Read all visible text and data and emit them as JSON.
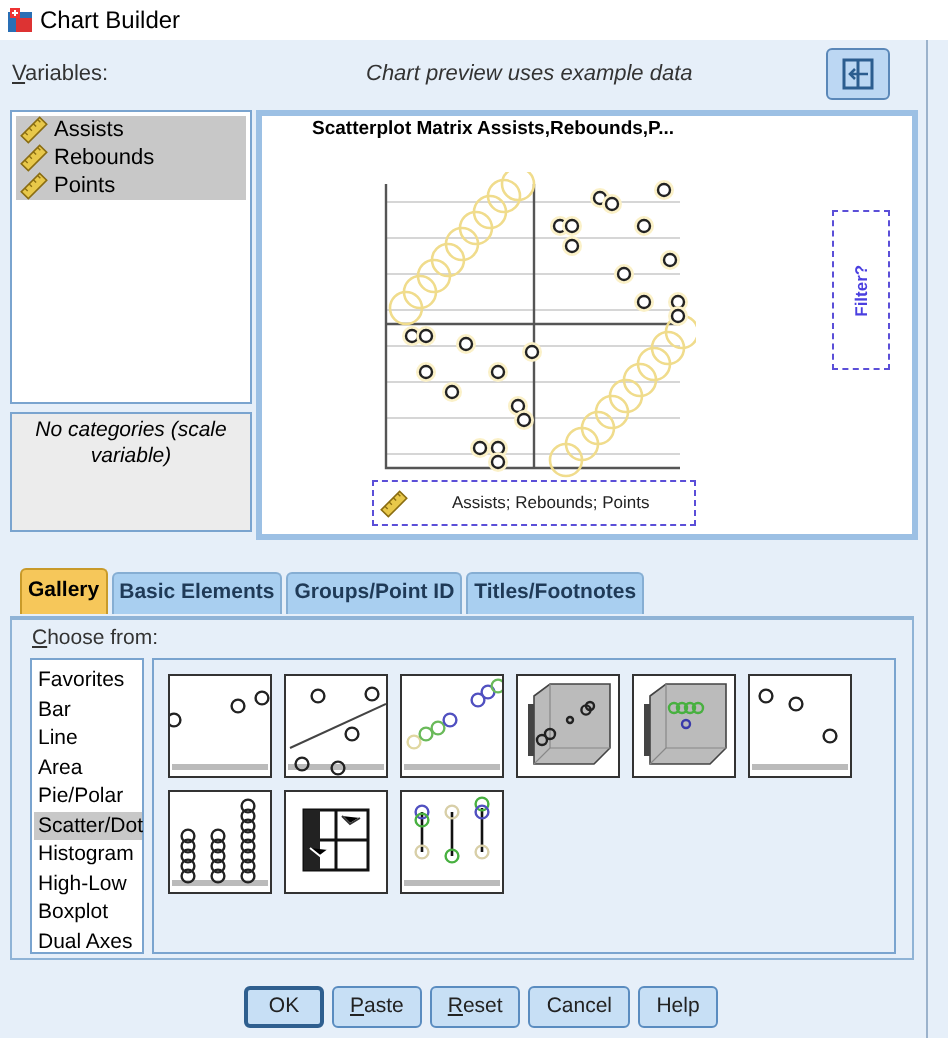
{
  "window": {
    "title": "Chart Builder"
  },
  "variables": {
    "label": "Variables:",
    "mnemonic": true,
    "items": [
      {
        "name": "Assists",
        "selected": true
      },
      {
        "name": "Rebounds",
        "selected": true
      },
      {
        "name": "Points",
        "selected": true
      }
    ]
  },
  "preview_note": "Chart preview uses example data",
  "categories_note": "No categories (scale variable)",
  "preview": {
    "title": "Scatterplot Matrix Assists,Rebounds,P...",
    "filter_label": "Filter?",
    "x_axis_label": "Assists; Rebounds; Points"
  },
  "tabs": [
    {
      "label": "Gallery",
      "selected": true
    },
    {
      "label": "Basic Elements",
      "selected": false
    },
    {
      "label": "Groups/Point ID",
      "selected": false
    },
    {
      "label": "Titles/Footnotes",
      "selected": false
    }
  ],
  "gallery": {
    "label": "Choose from:",
    "mnemonic": true,
    "types": [
      {
        "label": "Favorites",
        "selected": false
      },
      {
        "label": "Bar",
        "selected": false
      },
      {
        "label": "Line",
        "selected": false
      },
      {
        "label": "Area",
        "selected": false
      },
      {
        "label": "Pie/Polar",
        "selected": false
      },
      {
        "label": "Scatter/Dot",
        "selected": true
      },
      {
        "label": "Histogram",
        "selected": false
      },
      {
        "label": "High-Low",
        "selected": false
      },
      {
        "label": "Boxplot",
        "selected": false
      },
      {
        "label": "Dual Axes",
        "selected": false
      }
    ],
    "thumbnails": [
      {
        "kind": "simple"
      },
      {
        "kind": "fitline"
      },
      {
        "kind": "grouped"
      },
      {
        "kind": "cube"
      },
      {
        "kind": "cubegrouped"
      },
      {
        "kind": "summary"
      },
      {
        "kind": "dots"
      },
      {
        "kind": "matrix"
      },
      {
        "kind": "dropline"
      }
    ]
  },
  "buttons": [
    {
      "label": "OK",
      "default": true,
      "mnemonic": false
    },
    {
      "label": "Paste",
      "default": false,
      "mnemonic": true
    },
    {
      "label": "Reset",
      "default": false,
      "mnemonic": true
    },
    {
      "label": "Cancel",
      "default": false,
      "mnemonic": false
    },
    {
      "label": "Help",
      "default": false,
      "mnemonic": false
    }
  ]
}
